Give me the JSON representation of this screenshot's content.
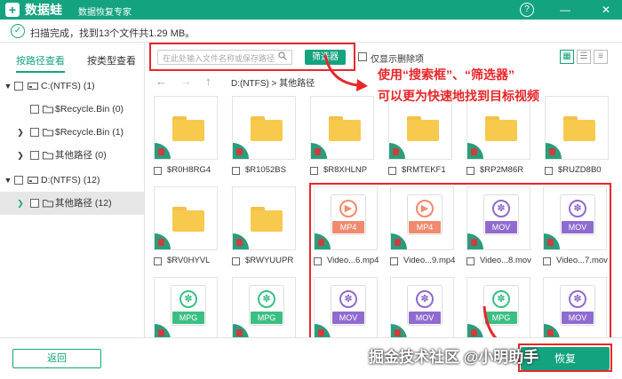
{
  "app": {
    "brand": "数据蛙",
    "subtitle": "数据恢复专家",
    "help_icon": "?",
    "min_icon": "—",
    "close_icon": "✕"
  },
  "status": {
    "text": "扫描完成，找到13个文件共1.29 MB。"
  },
  "sidebar": {
    "tabs": [
      {
        "label": "按路径查看"
      },
      {
        "label": "按类型查看"
      }
    ],
    "tree": [
      {
        "label": "C:(NTFS) (1)"
      },
      {
        "label": "$Recycle.Bin (0)"
      },
      {
        "label": "$Recycle.Bin (1)"
      },
      {
        "label": "其他路径 (0)"
      },
      {
        "label": "D:(NTFS) (12)"
      },
      {
        "label": "其他路径 (12)"
      }
    ]
  },
  "toolbar": {
    "search_placeholder": "在此处输入文件名称或保存路径",
    "filter_label": "筛选器",
    "show_deleted_label": "仅显示删除项"
  },
  "nav": {
    "path": "D:(NTFS) > 其他路径"
  },
  "files": [
    {
      "name": "$R0H8RG4"
    },
    {
      "name": "$R1052BS"
    },
    {
      "name": "$R8XHLNP"
    },
    {
      "name": "$RMTEKF1"
    },
    {
      "name": "$RP2M86R"
    },
    {
      "name": "$RUZD8B0"
    },
    {
      "name": "$RV0HYVL"
    },
    {
      "name": "$RWYUUPR"
    },
    {
      "name": "Video...6.mp4",
      "tag": "MP4"
    },
    {
      "name": "Video...9.mp4",
      "tag": "MP4"
    },
    {
      "name": "Video...8.mov",
      "tag": "MOV"
    },
    {
      "name": "Video...7.mov",
      "tag": "MOV"
    },
    {
      "tag": "MPG"
    },
    {
      "tag": "MPG"
    },
    {
      "tag": "MOV"
    },
    {
      "tag": "MOV"
    },
    {
      "tag": "MPG"
    },
    {
      "tag": "MOV"
    }
  ],
  "footer": {
    "back_label": "返回",
    "recover_label": "恢复"
  },
  "annotation": {
    "line1": "使用“搜索框”、“筛选器”",
    "line2": "可以更为快速地找到目标视频"
  },
  "watermark": "掘金技术社区 @小明助手",
  "colors": {
    "accent": "#14a37f",
    "mp4": "#f08a6e",
    "mov": "#8f6bd0",
    "mpg": "#3cbf84",
    "annot": "#e8262a"
  }
}
